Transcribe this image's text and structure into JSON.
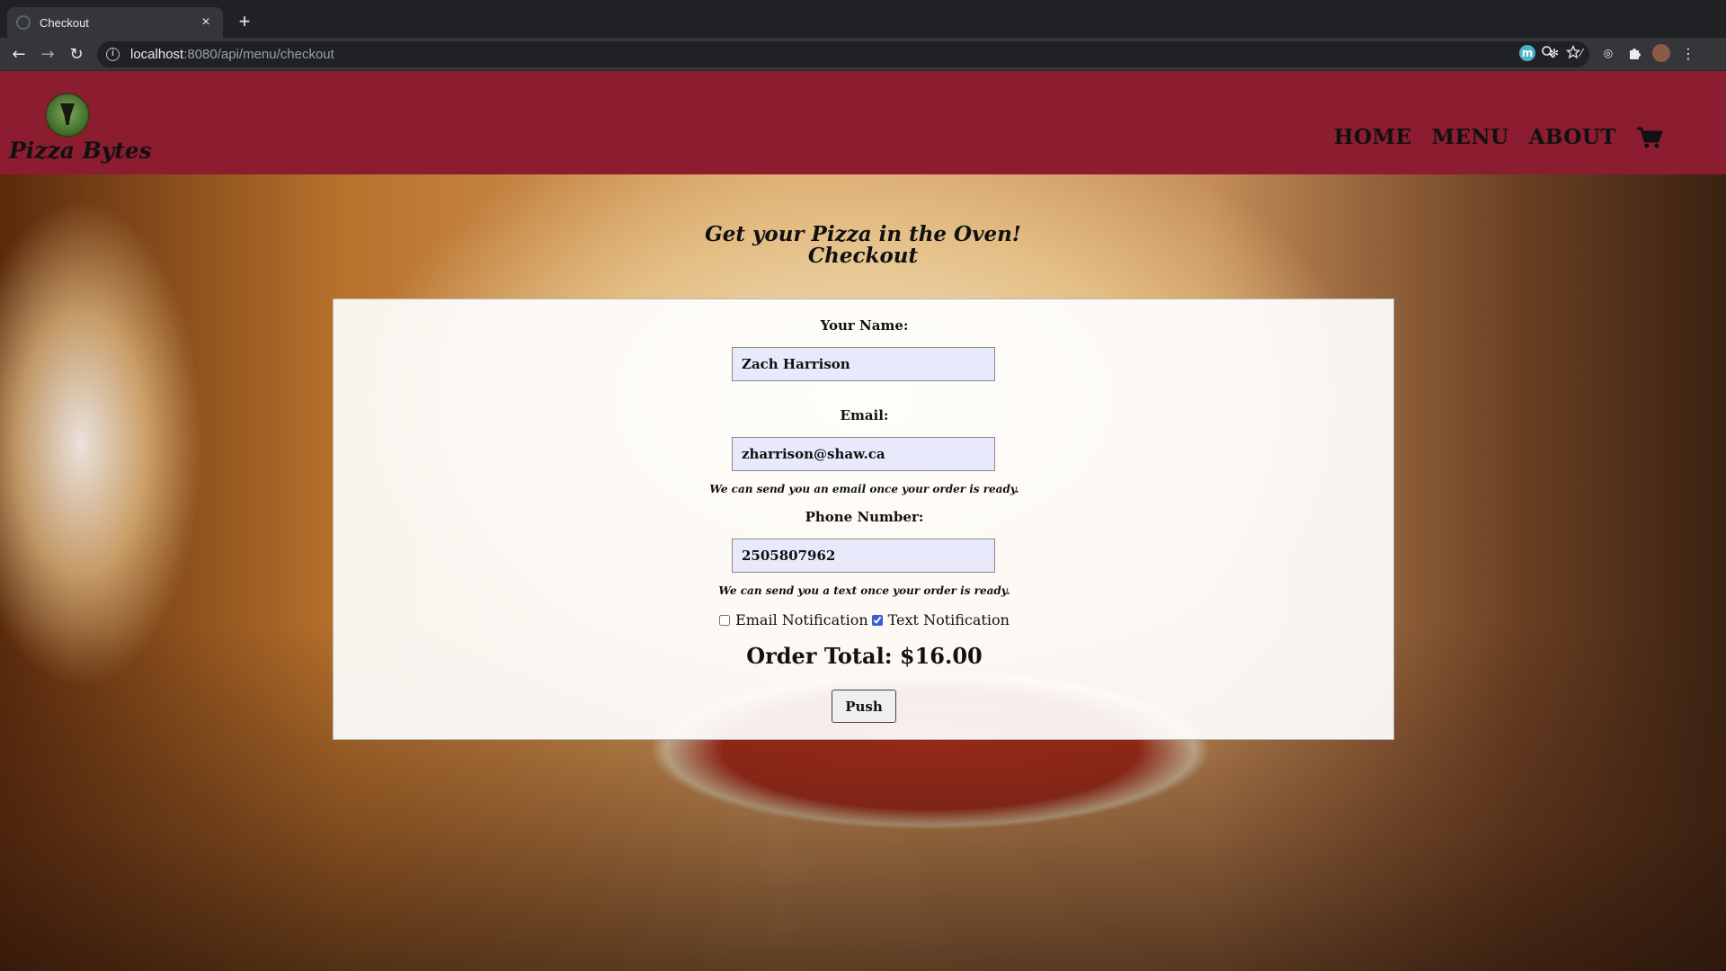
{
  "browser": {
    "tab_title": "Checkout",
    "tab_close": "×",
    "new_tab": "+",
    "url_host": "localhost",
    "url_path": ":8080/api/menu/checkout",
    "back": "←",
    "forward": "→",
    "reload": "↻",
    "extension_m": "m",
    "icons": [
      "info-icon",
      "zoom-icon",
      "star-icon",
      "extension-icon",
      "puzzle-icon",
      "profile-avatar",
      "kebab-menu-icon"
    ]
  },
  "site": {
    "logo_text": "Pizza Bytes",
    "nav": {
      "home": "HOME",
      "menu": "MENU",
      "about": "ABOUT"
    },
    "brand_color": "#8c1c2f"
  },
  "checkout": {
    "heading_line1": "Get your Pizza in the Oven!",
    "heading_line2": "Checkout",
    "name_label": "Your Name:",
    "name_value": "Zach Harrison",
    "email_label": "Email:",
    "email_value": "zharrison@shaw.ca",
    "email_hint": "We can send you an email once your order is ready.",
    "phone_label": "Phone Number:",
    "phone_value": "2505807962",
    "phone_hint": "We can send you a text once your order is ready.",
    "email_notification_label": "Email Notification",
    "email_notification_checked": false,
    "text_notification_label": "Text Notification",
    "text_notification_checked": true,
    "order_total": "Order Total: $16.00",
    "submit_label": "Push"
  }
}
